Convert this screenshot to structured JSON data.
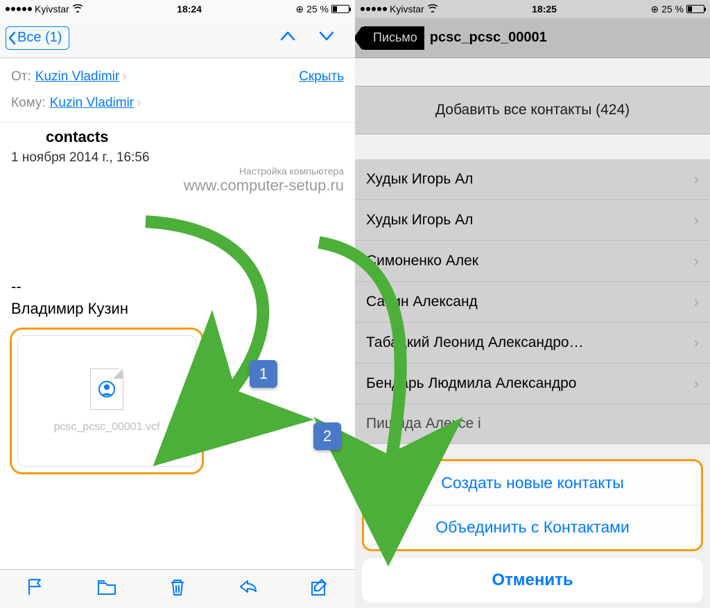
{
  "left": {
    "status": {
      "carrier": "Kyivstar",
      "time": "18:24",
      "battery": "25 %"
    },
    "nav": {
      "back_label": "Все (1)"
    },
    "meta": {
      "from_label": "От:",
      "from_value": "Kuzin Vladimir",
      "hide": "Скрыть",
      "to_label": "Кому:",
      "to_value": "Kuzin Vladimir"
    },
    "subject": "contacts",
    "date": "1 ноября 2014 г., 16:56",
    "watermark_small": "Настройка компьютера",
    "watermark_url": "www.computer-setup.ru",
    "dashes": "--",
    "signature": "Владимир Кузин",
    "attachment_name": "pcsc_pcsc_00001.vcf"
  },
  "right": {
    "status": {
      "carrier": "Kyivstar",
      "time": "18:25",
      "battery": "25 %"
    },
    "nav": {
      "back_label": "Письмо",
      "title": "pcsc_pcsc_00001"
    },
    "add_all": "Добавить все контакты (424)",
    "contacts": [
      "Худык Игорь Ал",
      "Худык Игорь Ал",
      "Симоненко Алек",
      "Савин Александ",
      "Табацкий Леонид Александро…",
      "Бендарь Людмила Александро"
    ],
    "peeking": "Пищида Алексе і",
    "sheet": {
      "create": "Создать новые контакты",
      "merge": "Объединить с Контактами",
      "cancel": "Отменить"
    }
  },
  "bubbles": {
    "one": "1",
    "two": "2"
  }
}
